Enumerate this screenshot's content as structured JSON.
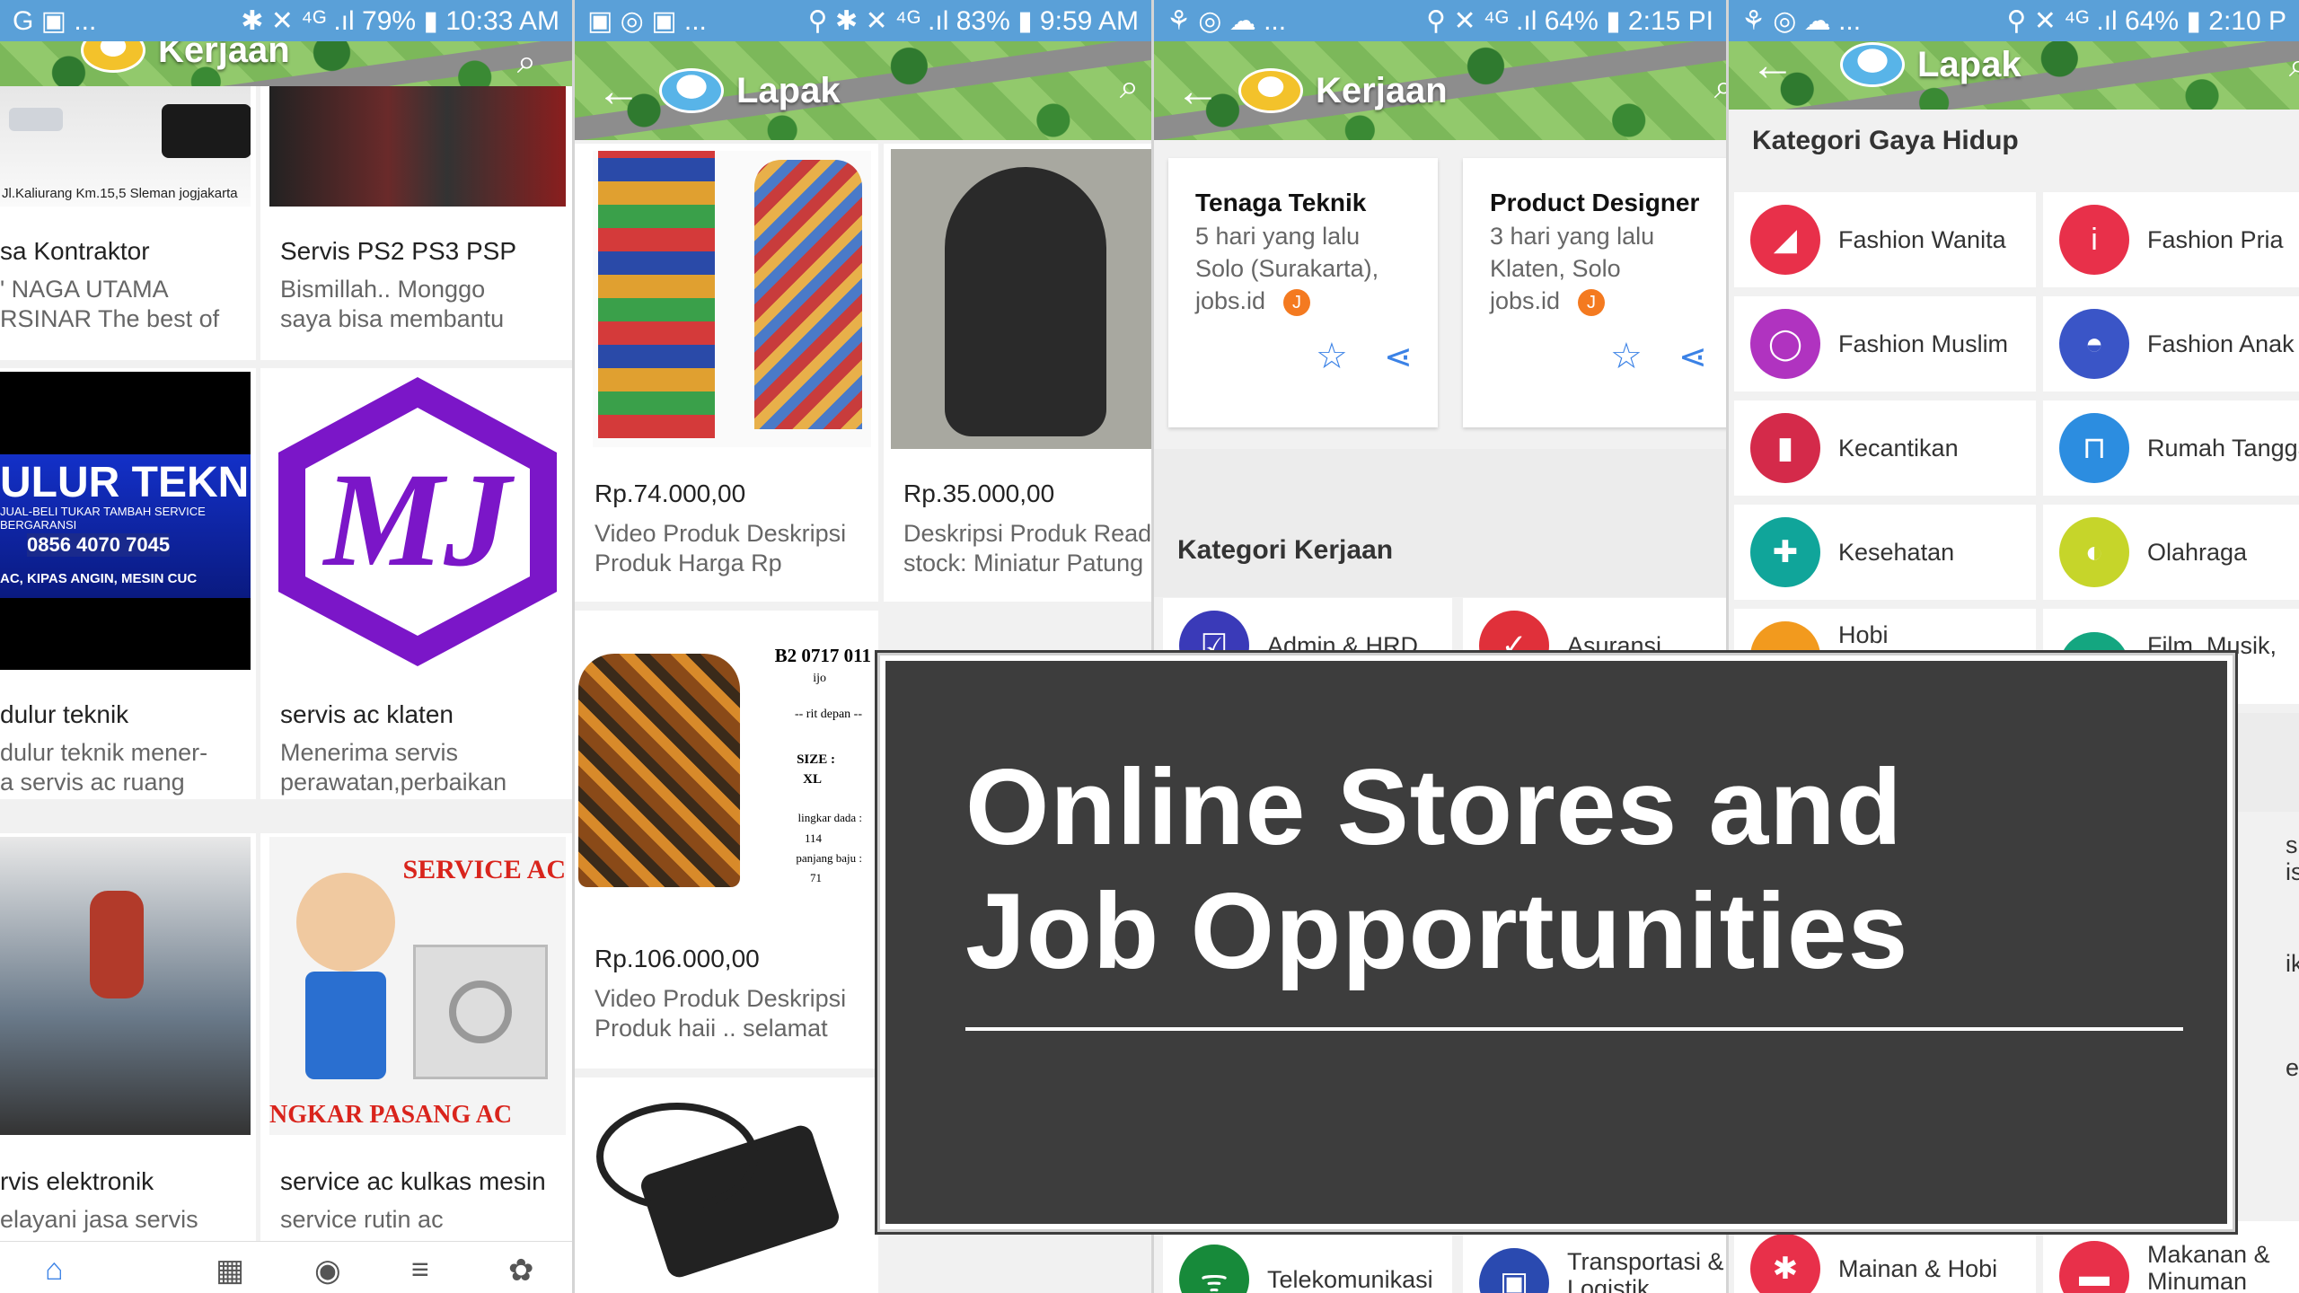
{
  "p1": {
    "status": {
      "left": "G ▣ ...",
      "right": "✱ ✕ ⁴ᴳ .ıl 79% ▮ 10:33 AM"
    },
    "title": "Kerjaan",
    "cards": [
      {
        "title": "sa Kontraktor",
        "sub1": "' NAGA UTAMA",
        "sub2": "RSINAR The best of",
        "ph_text": "Jl.Kaliurang Km.15,5 Sleman jogjakarta"
      },
      {
        "title": "Servis PS2 PS3 PSP",
        "sub1": "Bismillah.. Monggo",
        "sub2": "saya bisa membantu"
      },
      {
        "title": "dulur teknik",
        "sub1": "dulur teknik mener-",
        "sub2": "a servis ac ruang",
        "ph_text": "ULUR TEKNI",
        "ph_text2": "JUAL-BELI TUKAR TAMBAH SERVICE BERGARANSI",
        "ph_phone": "0856 4070 7045",
        "ph_text3": "AC, KIPAS ANGIN, MESIN CUC"
      },
      {
        "title": "servis ac klaten",
        "sub1": "Menerima servis",
        "sub2": "perawatan,perbaikan",
        "ph_logo": "MJ"
      },
      {
        "title": "rvis elektronik",
        "sub1": "elayani jasa servis",
        "sub2": ""
      },
      {
        "title": "service ac kulkas mesin",
        "sub1": "service rutin ac",
        "sub2": "",
        "ph_top": "SERVICE AC",
        "ph_bottom": "NGKAR PASANG AC"
      }
    ],
    "nav": [
      "⌂",
      "▦",
      "◉",
      "≡",
      "✿"
    ]
  },
  "p2": {
    "status": {
      "left": "▣ ◎ ▣ ...",
      "right": "⚲ ✱ ✕ ⁴ᴳ .ıl 83% ▮ 9:59 AM"
    },
    "title": "Lapak",
    "cards": [
      {
        "price": "Rp.74.000,00",
        "sub1": "Video Produk Deskripsi",
        "sub2": "Produk Harga Rp"
      },
      {
        "price": "Rp.35.000,00",
        "sub1": "Deskripsi Produk Read",
        "sub2": "stock: Miniatur Patung"
      },
      {
        "price": "Rp.106.000,00",
        "sub1": "Video Produk Deskripsi",
        "sub2": "Produk haii .. selamat",
        "ph_label1": "B2 0717 011",
        "ph_label2": "ijo",
        "ph_label3": "-- rit depan --",
        "ph_label4": "SIZE :",
        "ph_label5": "XL",
        "ph_label6": "lingkar dada :",
        "ph_label7": "114",
        "ph_label8": "panjang baju :",
        "ph_label9": "71"
      }
    ]
  },
  "p3": {
    "status": {
      "left": "⚘ ◎ ☁ ...",
      "right": "⚲ ✕ ⁴ᴳ .ıl 64% ▮ 2:15 PI"
    },
    "title": "Kerjaan",
    "jobs": [
      {
        "title": "Tenaga Teknik",
        "time": "5 hari yang lalu",
        "loc": "Solo (Surakarta),",
        "src": "jobs.id",
        "badge": "J"
      },
      {
        "title": "Product Designer",
        "time": "3 hari yang lalu",
        "loc": "Klaten, Solo",
        "src": "jobs.id",
        "badge": "J"
      }
    ],
    "section": "Kategori Kerjaan",
    "cats_top": [
      "Admin & HRD",
      "Asuransi"
    ],
    "cats_bottom": [
      "Telekomunikasi",
      "Transportasi & Logistik"
    ]
  },
  "p4": {
    "status": {
      "left": "⚘ ◎ ☁ ...",
      "right": "⚲ ✕ ⁴ᴳ .ıl 64% ▮ 2:10 P"
    },
    "title": "Lapak",
    "section": "Kategori Gaya Hidup",
    "cats": [
      {
        "label": "Fashion Wanita",
        "color": "#e8304a",
        "icon": "◢"
      },
      {
        "label": "Fashion Pria",
        "color": "#e8304a",
        "icon": "i"
      },
      {
        "label": "Fashion Muslim",
        "color": "#b033c0",
        "icon": "◯"
      },
      {
        "label": "Fashion Anak",
        "color": "#3a55c7",
        "icon": "◓"
      },
      {
        "label": "Kecantikan",
        "color": "#d42a4a",
        "icon": "▮"
      },
      {
        "label": "Rumah Tangga",
        "color": "#2c8de0",
        "icon": "⊓"
      },
      {
        "label": "Kesehatan",
        "color": "#10a59a",
        "icon": "✚"
      },
      {
        "label": "Olahraga",
        "color": "#c6d52a",
        "icon": "◐"
      },
      {
        "label": "Hobi",
        "color": "#f29a1e",
        "icon": "●"
      },
      {
        "label": "Film, Musik,",
        "color": "#14a680",
        "icon": "▭"
      }
    ],
    "peek": [
      "s",
      "is",
      "ik",
      "e"
    ],
    "cats_bottom": [
      {
        "label": "Mainan & Hobi",
        "color": "#e8304a",
        "icon": "✱"
      },
      {
        "label": "Makanan & Minuman",
        "color": "#e8304a",
        "icon": "▬",
        "label1": "Makanan &",
        "label2": "Minuman"
      }
    ]
  },
  "overlay": {
    "line1": "Online Stores and",
    "line2": "Job Opportunities"
  }
}
